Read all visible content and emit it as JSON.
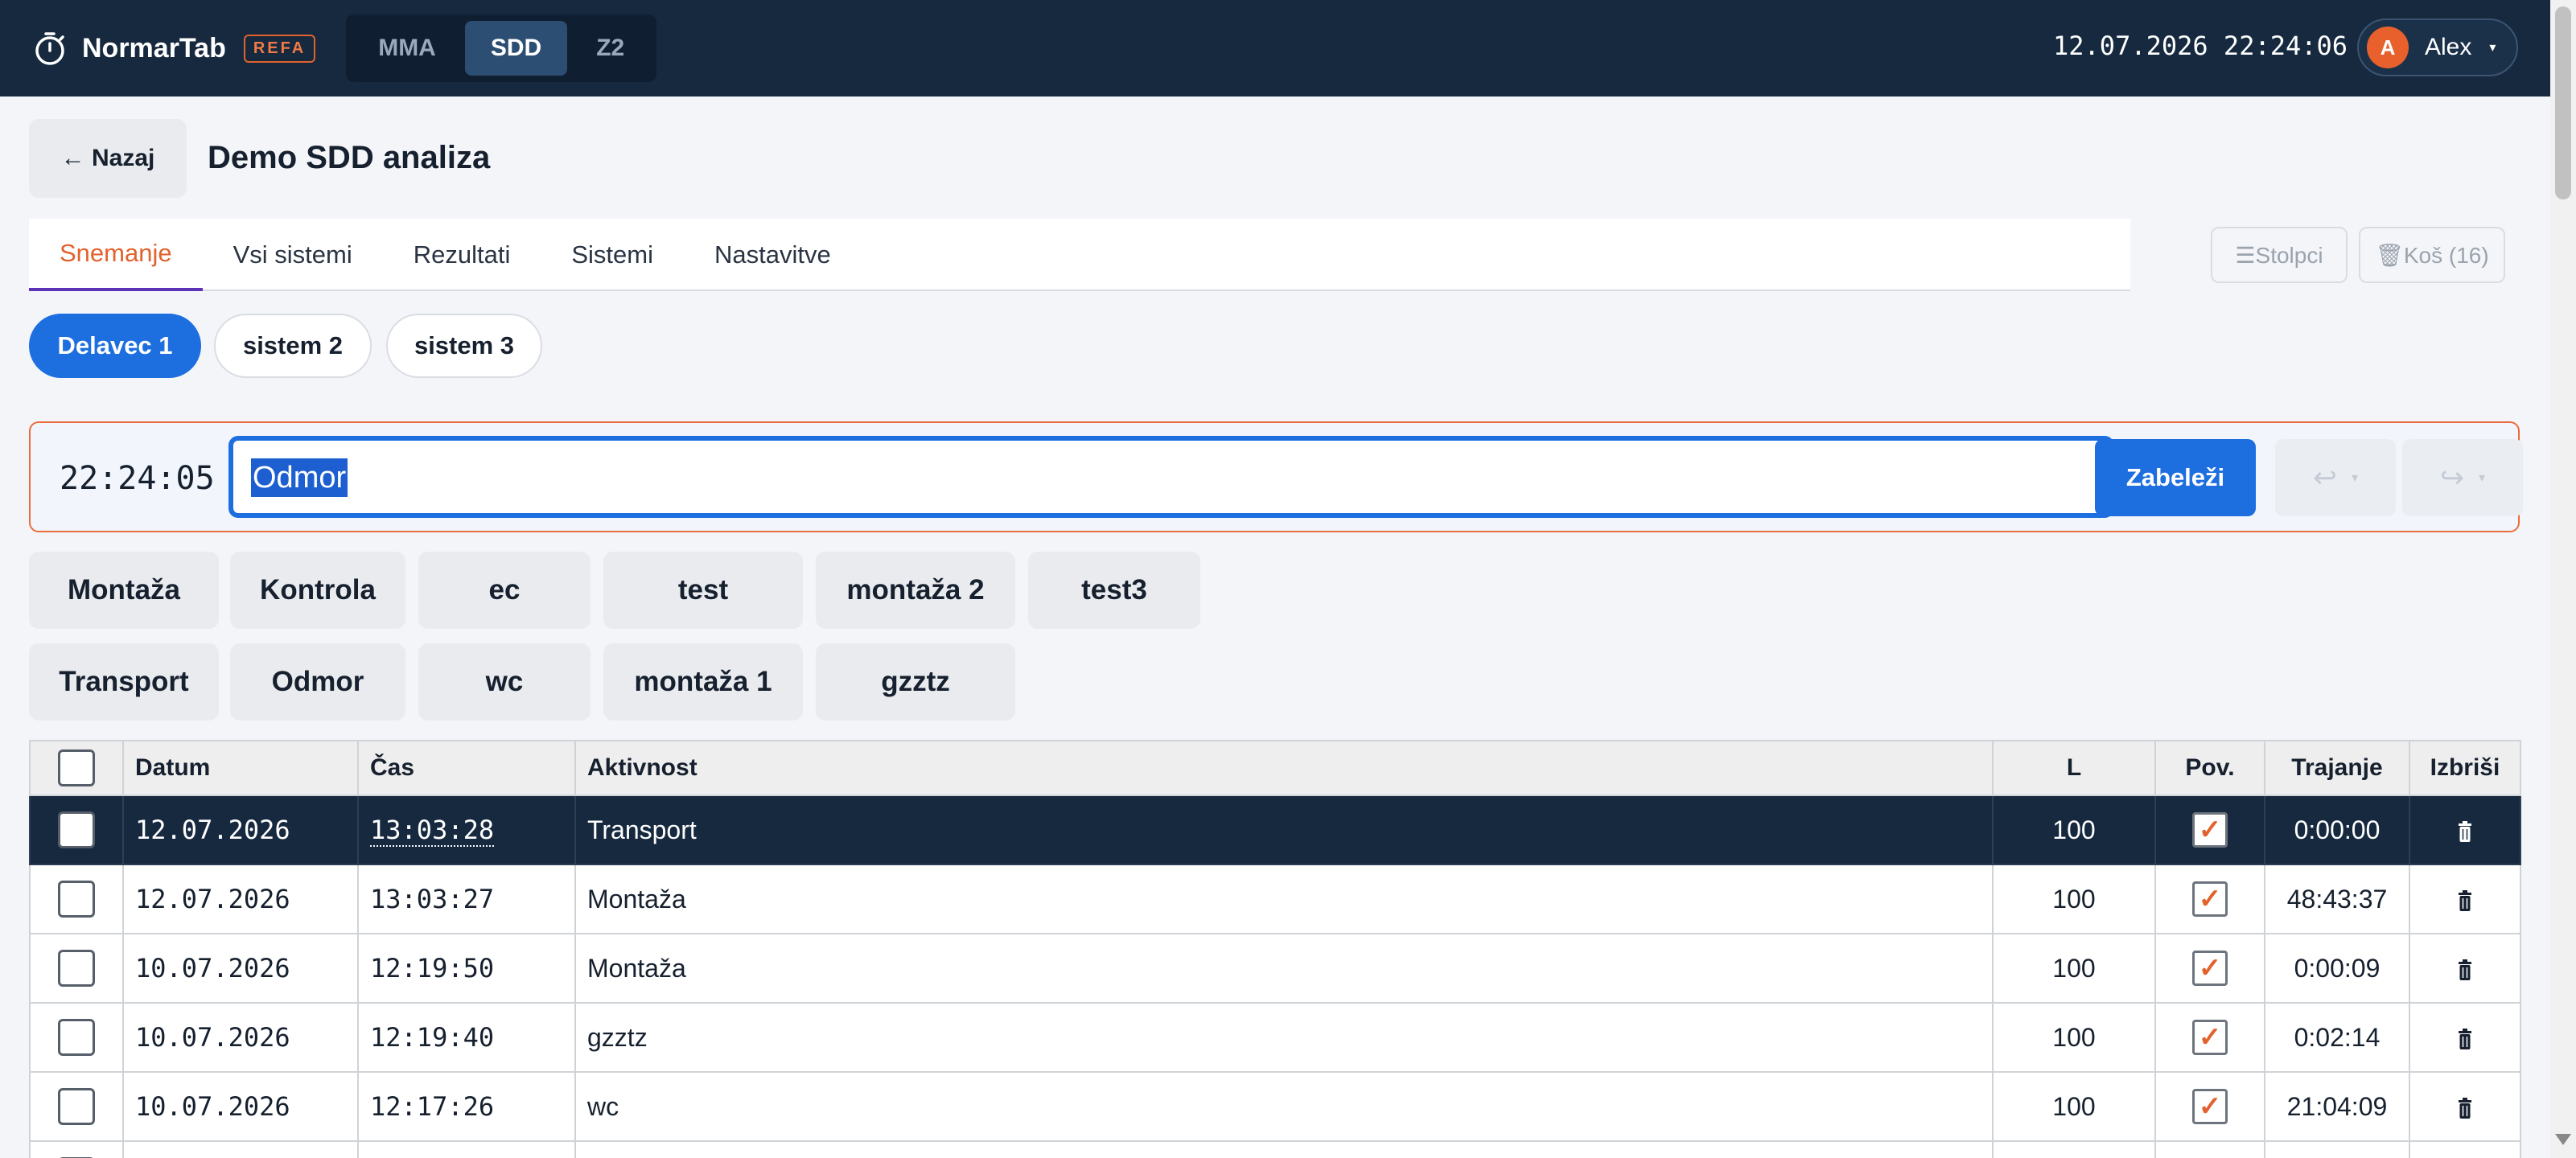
{
  "app": {
    "name": "NormarTab",
    "badge": "REFA"
  },
  "modes": [
    {
      "label": "MMA",
      "active": false
    },
    {
      "label": "SDD",
      "active": true
    },
    {
      "label": "Z2",
      "active": false
    }
  ],
  "clock": "12.07.2026 22:24:06",
  "user": {
    "initial": "A",
    "name": "Alex"
  },
  "header": {
    "back_label": "← Nazaj",
    "title": "Demo SDD analiza"
  },
  "tabs": [
    {
      "label": "Snemanje"
    },
    {
      "label": "Vsi sistemi"
    },
    {
      "label": "Rezultati"
    },
    {
      "label": "Sistemi"
    },
    {
      "label": "Nastavitve"
    }
  ],
  "toolbar": {
    "columns_label": "☰Stolpci",
    "trash_label": "🗑Koš (16)"
  },
  "workers": [
    {
      "label": "Delavec 1"
    },
    {
      "label": "sistem 2"
    },
    {
      "label": "sistem 3"
    }
  ],
  "recorder": {
    "time": "22:24:05",
    "input_value": "Odmor",
    "log_label": "Zabeleži",
    "undo_icon": "↩",
    "redo_icon": "↪"
  },
  "activities": {
    "row1": [
      "Montaža",
      "Kontrola",
      "ec",
      "test",
      "montaža 2",
      "test3"
    ],
    "row2": [
      "Transport",
      "Odmor",
      "wc",
      "montaža 1",
      "gzztz"
    ]
  },
  "table": {
    "headers": {
      "datum": "Datum",
      "cas": "Čas",
      "aktivnost": "Aktivnost",
      "l": "L",
      "pov": "Pov.",
      "trajanje": "Trajanje",
      "izbrisi": "Izbriši"
    },
    "rows": [
      {
        "datum": "12.07.2026",
        "cas": "13:03:28",
        "aktivnost": "Transport",
        "l": "100",
        "trajanje": "0:00:00"
      },
      {
        "datum": "12.07.2026",
        "cas": "13:03:27",
        "aktivnost": "Montaža",
        "l": "100",
        "trajanje": "48:43:37"
      },
      {
        "datum": "10.07.2026",
        "cas": "12:19:50",
        "aktivnost": "Montaža",
        "l": "100",
        "trajanje": "0:00:09"
      },
      {
        "datum": "10.07.2026",
        "cas": "12:19:40",
        "aktivnost": "gzztz",
        "l": "100",
        "trajanje": "0:02:14"
      },
      {
        "datum": "10.07.2026",
        "cas": "12:17:26",
        "aktivnost": "wc",
        "l": "100",
        "trajanje": "21:04:09"
      }
    ]
  }
}
